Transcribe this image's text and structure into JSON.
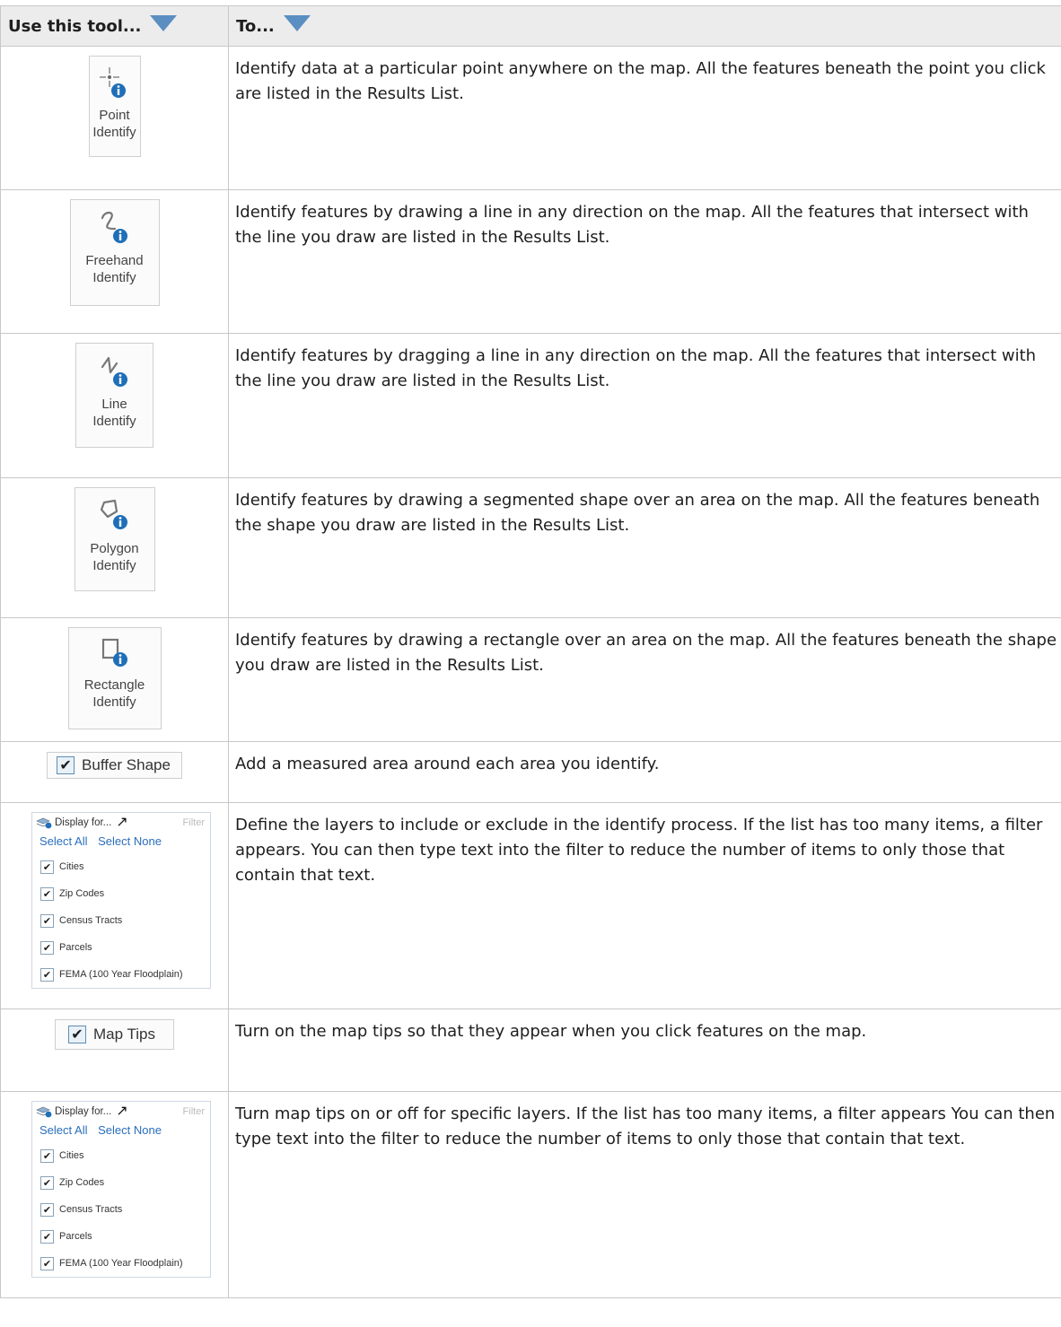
{
  "header": {
    "col1": "Use this tool...",
    "col2": "To..."
  },
  "rows": [
    {
      "tool": {
        "line1": "Point",
        "line2": "Identify"
      },
      "desc": "Identify data at a particular point anywhere on the map. All the features beneath the point you click are listed in the Results List."
    },
    {
      "tool": {
        "line1": "Freehand",
        "line2": "Identify"
      },
      "desc": "Identify features by drawing a line in any direction on the map. All the features that intersect with the line you draw are listed in the Results List."
    },
    {
      "tool": {
        "line1": "Line",
        "line2": "Identify"
      },
      "desc": "Identify features by dragging a line in any direction on the map. All the features that intersect with the line you draw are listed in the Results List."
    },
    {
      "tool": {
        "line1": "Polygon",
        "line2": "Identify"
      },
      "desc": "Identify features by drawing a segmented shape over an area on the map. All the features beneath the shape you draw are listed in the Results List."
    },
    {
      "tool": {
        "line1": "Rectangle",
        "line2": "Identify"
      },
      "desc": "Identify features by drawing a rectangle over an area on the map. All the features beneath the shape you draw are listed in the Results List."
    },
    {
      "tool": {
        "label": "Buffer Shape"
      },
      "desc": "Add a measured area around each area you identify."
    },
    {
      "tool": {
        "display": "Display for...",
        "filter": "Filter",
        "select_all": "Select All",
        "select_none": "Select None",
        "items": [
          "Cities",
          "Zip Codes",
          "Census Tracts",
          "Parcels",
          "FEMA (100 Year Floodplain)"
        ]
      },
      "desc": "Define the layers to include or exclude in the identify process. If the list has too many items, a filter appears. You can then type text into the filter to reduce the number of items to only those that contain that text."
    },
    {
      "tool": {
        "label": "Map Tips"
      },
      "desc": "Turn on the map tips so that they appear when you click features on the map."
    },
    {
      "tool": {
        "display": "Display for...",
        "filter": "Filter",
        "select_all": "Select All",
        "select_none": "Select None",
        "items": [
          "Cities",
          "Zip Codes",
          "Census Tracts",
          "Parcels",
          "FEMA (100 Year Floodplain)"
        ]
      },
      "desc": "Turn map tips on or off for specific layers. If the list has too many items, a filter appears You can then type text into the filter to reduce the number of items to only those that contain that text."
    }
  ],
  "colors": {
    "accent": "#5b8fc2",
    "info_icon": "#1f6fb8",
    "header_bg": "#ececec",
    "border": "#c8c8c8"
  }
}
